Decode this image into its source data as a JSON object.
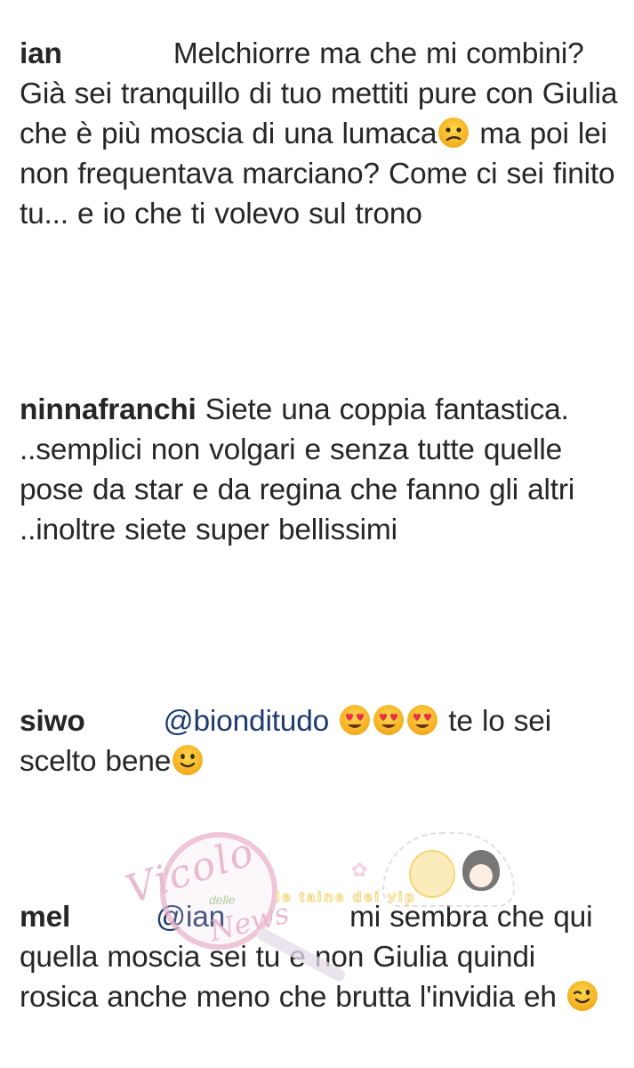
{
  "comments": [
    {
      "username": "ian",
      "gap": "             ",
      "text_parts": [
        "Melchiorre ma che mi combini? Già sei tranquillo di tuo mettiti pure con Giulia che è più moscia di una lumaca",
        " ma poi lei non frequentava marciano? Come ci sei finito tu... e io che ti volevo sul trono"
      ],
      "emojis": [
        "confused-face-emoji"
      ]
    },
    {
      "username": "ninnafranchi",
      "text_parts": [
        "Siete una coppia fantastica. ..semplici non volgari e senza tutte  quelle pose da star e da regina che fanno gli altri ..inoltre siete super bellissimi"
      ]
    },
    {
      "username": "siwo",
      "mention": "@bionditudo",
      "text_parts": [
        " te lo sei scelto bene"
      ],
      "emojis": [
        "heart-eyes-emoji",
        "heart-eyes-emoji",
        "heart-eyes-emoji",
        "slightly-smiling-face-emoji"
      ]
    },
    {
      "username": "mel",
      "mention": "@ian",
      "text_parts": [
        "mi sembra che qui quella moscia sei tu e non Giulia quindi rosica anche meno che brutta l'invidia eh "
      ],
      "emojis": [
        "winking-face-emoji"
      ]
    }
  ],
  "watermark": {
    "script_line1": "Vicolo",
    "small_word": "delle",
    "script_line2": "News",
    "banner": "le taine dei vip"
  },
  "colors": {
    "text": "#262626",
    "mention": "#1d3b6e",
    "emoji_yellow": "#f7c32e",
    "watermark_pink": "#e4a3c0"
  }
}
